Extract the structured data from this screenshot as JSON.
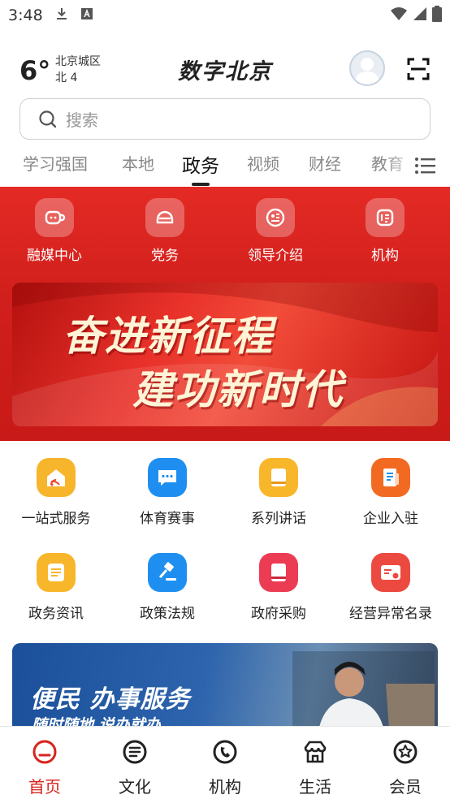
{
  "status_bar": {
    "time": "3:48"
  },
  "header": {
    "temperature": "6°",
    "location": "北京城区",
    "wind": "北 4",
    "brand": "数字北京"
  },
  "search": {
    "placeholder": "搜索"
  },
  "tabs": [
    {
      "label": "学习强国",
      "active": false
    },
    {
      "label": "本地",
      "active": false
    },
    {
      "label": "政务",
      "active": true
    },
    {
      "label": "视频",
      "active": false
    },
    {
      "label": "财经",
      "active": false
    },
    {
      "label": "教育",
      "active": false
    }
  ],
  "quick_links": [
    {
      "label": "融媒中心",
      "icon": "cup-icon"
    },
    {
      "label": "党务",
      "icon": "party-icon"
    },
    {
      "label": "领导介绍",
      "icon": "leader-icon"
    },
    {
      "label": "机构",
      "icon": "organization-icon"
    }
  ],
  "banner": {
    "line1": "奋进新征程",
    "line2": "建功新时代"
  },
  "services": [
    {
      "label": "一站式服务",
      "icon": "home-wifi-icon",
      "color": "#f7b52c"
    },
    {
      "label": "体育赛事",
      "icon": "chat-bubble-icon",
      "color": "#1e8ff0"
    },
    {
      "label": "系列讲话",
      "icon": "book-icon",
      "color": "#f8b62a"
    },
    {
      "label": "企业入驻",
      "icon": "document-icon",
      "color": "#f26a22"
    },
    {
      "label": "政务资讯",
      "icon": "news-icon",
      "color": "#f8b62a"
    },
    {
      "label": "政策法规",
      "icon": "gavel-icon",
      "color": "#1e8ff0"
    },
    {
      "label": "政府采购",
      "icon": "purchase-book-icon",
      "color": "#ec3c54"
    },
    {
      "label": "经营异常名录",
      "icon": "id-card-icon",
      "color": "#ec4a40"
    }
  ],
  "banner2": {
    "title": "便民 办事服务",
    "subtitle": "随时随地 说办就办"
  },
  "bottom_nav": [
    {
      "label": "首页",
      "icon": "home-icon",
      "active": true
    },
    {
      "label": "文化",
      "icon": "culture-icon",
      "active": false
    },
    {
      "label": "机构",
      "icon": "organization-icon",
      "active": false
    },
    {
      "label": "生活",
      "icon": "life-icon",
      "active": false
    },
    {
      "label": "会员",
      "icon": "member-icon",
      "active": false
    }
  ],
  "colors": {
    "accent": "#d8231d",
    "banner_red": "#e42a24"
  }
}
